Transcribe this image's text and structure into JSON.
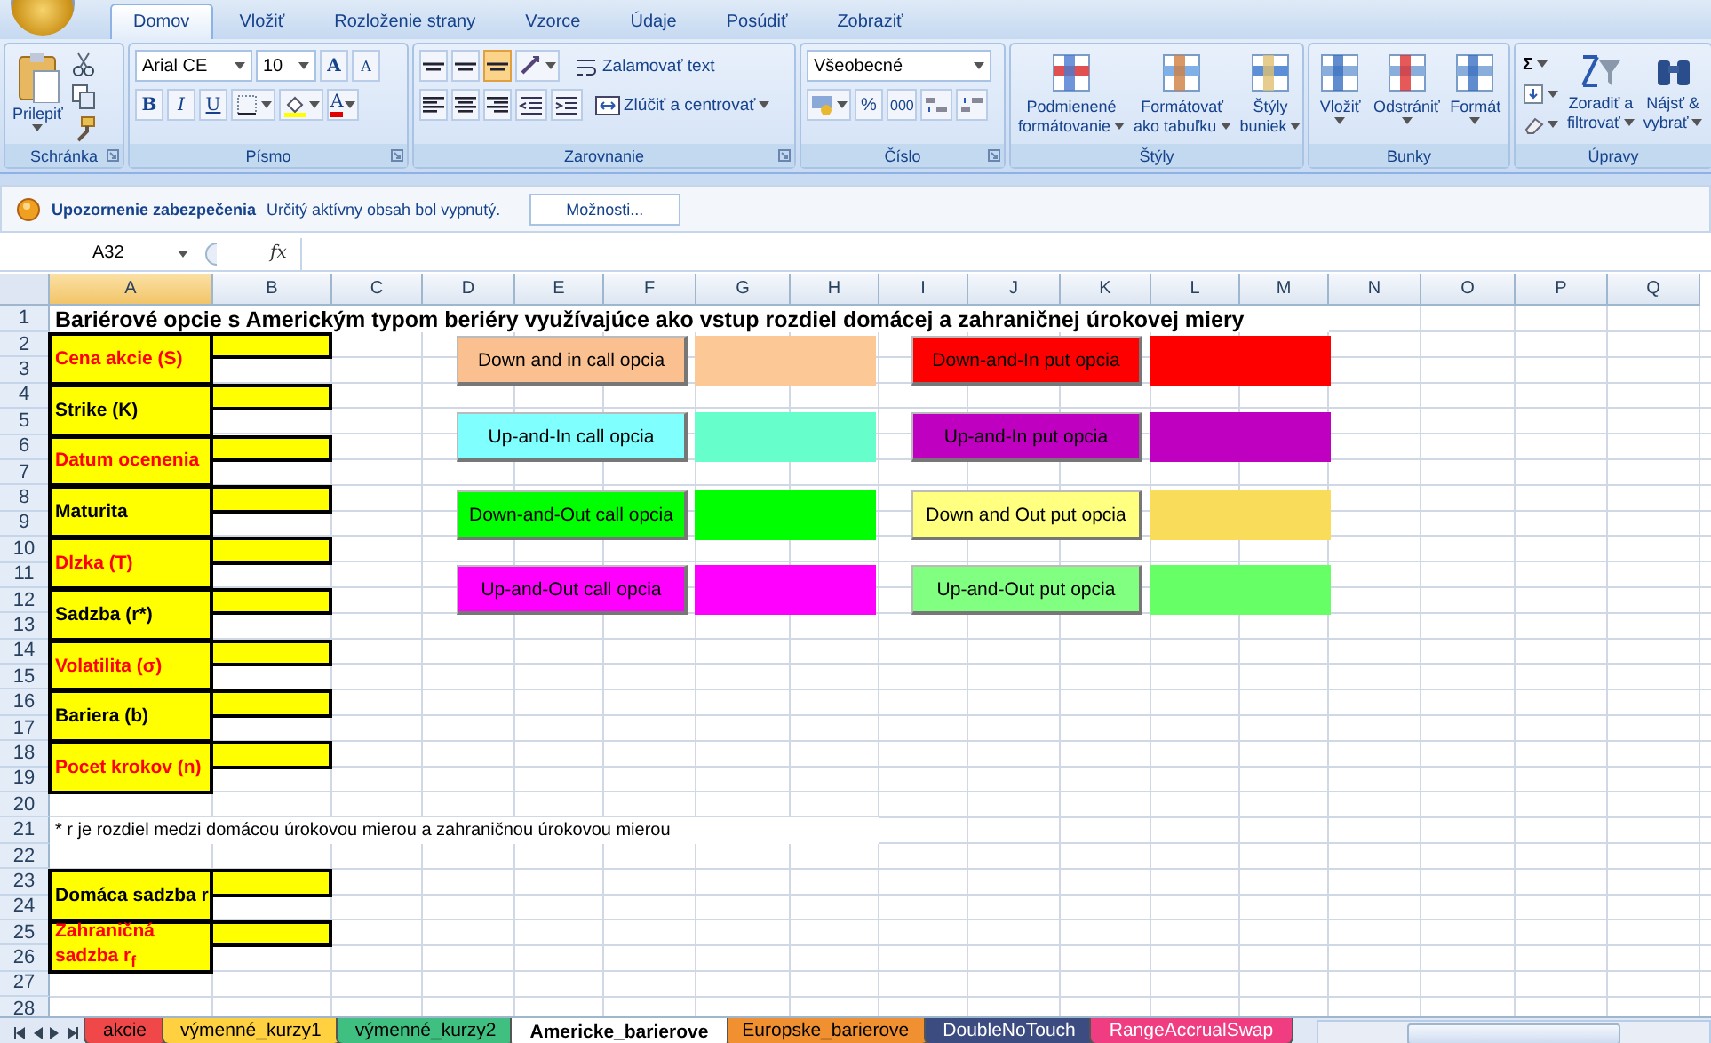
{
  "tabs": [
    {
      "label": "Domov",
      "selected": true
    },
    {
      "label": "Vložiť",
      "selected": false
    },
    {
      "label": "Rozloženie strany",
      "selected": false
    },
    {
      "label": "Vzorce",
      "selected": false
    },
    {
      "label": "Údaje",
      "selected": false
    },
    {
      "label": "Posúdiť",
      "selected": false
    },
    {
      "label": "Zobraziť",
      "selected": false
    }
  ],
  "clipboard": {
    "paste": "Prilepiť",
    "label": "Schránka"
  },
  "font": {
    "name": "Arial CE",
    "size": "10",
    "grow": "A",
    "shrink": "A",
    "bold": "B",
    "italic": "I",
    "underline": "U",
    "color_letter": "A",
    "label": "Písmo"
  },
  "alignment": {
    "vertical": [
      {
        "selected": false
      },
      {
        "selected": false
      },
      {
        "selected": true
      }
    ],
    "wrap": "Zalamovať text",
    "merge": "Zlúčiť a centrovať",
    "label": "Zarovnanie"
  },
  "number": {
    "format": "Všeobecné",
    "percent": "%",
    "thousands": "000",
    "label": "Číslo"
  },
  "styles": {
    "items": [
      {
        "lines": [
          "Podmienené",
          "formátovanie"
        ]
      },
      {
        "lines": [
          "Formátovať",
          "ako tabuľku"
        ]
      },
      {
        "lines": [
          "Štýly",
          "buniek"
        ]
      }
    ],
    "label": "Štýly"
  },
  "cells": {
    "items": [
      "Vložiť",
      "Odstrániť",
      "Formát"
    ],
    "label": "Bunky"
  },
  "editing": {
    "sum": "Σ",
    "items": [
      {
        "lines": [
          "Zoradiť a",
          "filtrovať"
        ]
      },
      {
        "lines": [
          "Nájsť &",
          "vybrať"
        ]
      }
    ],
    "label": "Úpravy"
  },
  "security": {
    "title": "Upozornenie zabezpečenia",
    "message": "Určitý aktívny obsah bol vypnutý.",
    "button": "Možnosti..."
  },
  "formula_bar": {
    "name_box": "A32",
    "fx": "fx"
  },
  "sheet": {
    "columns": [
      {
        "label": "A",
        "selected": true
      },
      {
        "label": "B",
        "selected": false
      },
      {
        "label": "C",
        "selected": false
      },
      {
        "label": "D",
        "selected": false
      },
      {
        "label": "E",
        "selected": false
      },
      {
        "label": "F",
        "selected": false
      },
      {
        "label": "G",
        "selected": false
      },
      {
        "label": "H",
        "selected": false
      },
      {
        "label": "I",
        "selected": false
      },
      {
        "label": "J",
        "selected": false
      },
      {
        "label": "K",
        "selected": false
      },
      {
        "label": "L",
        "selected": false
      },
      {
        "label": "M",
        "selected": false
      },
      {
        "label": "N",
        "selected": false
      },
      {
        "label": "O",
        "selected": false
      },
      {
        "label": "P",
        "selected": false
      },
      {
        "label": "Q",
        "selected": false
      }
    ],
    "rows": [
      "1",
      "2",
      "3",
      "4",
      "5",
      "6",
      "7",
      "8",
      "9",
      "10",
      "11",
      "12",
      "13",
      "14",
      "15",
      "16",
      "17",
      "18",
      "19",
      "20",
      "21",
      "22",
      "23",
      "24",
      "25",
      "26",
      "27",
      "28"
    ],
    "title": "Bariérové opcie s Americkým typom beriéry využívajúce ako vstup rozdiel domácej a zahraničnej úrokovej miery",
    "inputs": [
      {
        "label": "Cena akcie (S)",
        "color": "#ff0000"
      },
      {
        "label": "Strike (K)",
        "color": "#000000"
      },
      {
        "label": "Datum ocenenia",
        "color": "#ff0000"
      },
      {
        "label": "Maturita",
        "color": "#000000"
      },
      {
        "label": "Dlzka (T)",
        "color": "#ff0000"
      },
      {
        "label": "Sadzba (r*)",
        "color": "#000000"
      },
      {
        "label": "Volatilita (σ)",
        "color": "#ff0000"
      },
      {
        "label": "Bariera (b)",
        "color": "#000000"
      },
      {
        "label": "Pocet krokov (n)",
        "color": "#ff0000"
      }
    ],
    "note": "* r je rozdiel medzi domácou úrokovou mierou a zahraničnou úrokovou mierou",
    "rate_inputs": [
      {
        "label": "Domáca sadzba r",
        "color": "#000000"
      },
      {
        "label": "Zahraničná sadzba r$_{f}$",
        "color": "#ff0000"
      }
    ],
    "call_buttons": [
      {
        "label": "Down and in call opcia",
        "color": "#fac08f"
      },
      {
        "label": "Up-and-In call opcia",
        "color": "#80ffff"
      },
      {
        "label": "Down-and-Out call opcia",
        "color": "#00ff00"
      },
      {
        "label": "Up-and-Out call opcia",
        "color": "#ff00ff"
      }
    ],
    "call_swatches": [
      {
        "color": "#fcc896"
      },
      {
        "color": "#66ffcc"
      },
      {
        "color": "#00ff00"
      },
      {
        "color": "#ff00ff"
      }
    ],
    "put_buttons": [
      {
        "label": "Down-and-In put opcia",
        "color": "#ff0000"
      },
      {
        "label": "Up-and-In put opcia",
        "color": "#c000c0"
      },
      {
        "label": "Down and Out put opcia",
        "color": "#ffff80"
      },
      {
        "label": "Up-and-Out put opcia",
        "color": "#80ff80"
      }
    ],
    "put_swatches": [
      {
        "color": "#ff0000"
      },
      {
        "color": "#c000c0"
      },
      {
        "color": "#f8dc5a"
      },
      {
        "color": "#66ff66"
      }
    ]
  },
  "sheet_tabs": [
    {
      "label": "akcie",
      "color": "#f04848",
      "selected": false
    },
    {
      "label": "výmenné_kurzy1",
      "color": "#ffd040",
      "selected": false
    },
    {
      "label": "výmenné_kurzy2",
      "color": "#40c080",
      "selected": false
    },
    {
      "label": "Americke_barierove",
      "color": "#ffffff",
      "selected": true
    },
    {
      "label": "Europske_barierove",
      "color": "#f09030",
      "selected": false
    },
    {
      "label": "DoubleNoTouch",
      "color": "#3c4c80",
      "selected": false
    },
    {
      "label": "RangeAccrualSwap",
      "color": "#f03c80",
      "selected": false
    }
  ]
}
